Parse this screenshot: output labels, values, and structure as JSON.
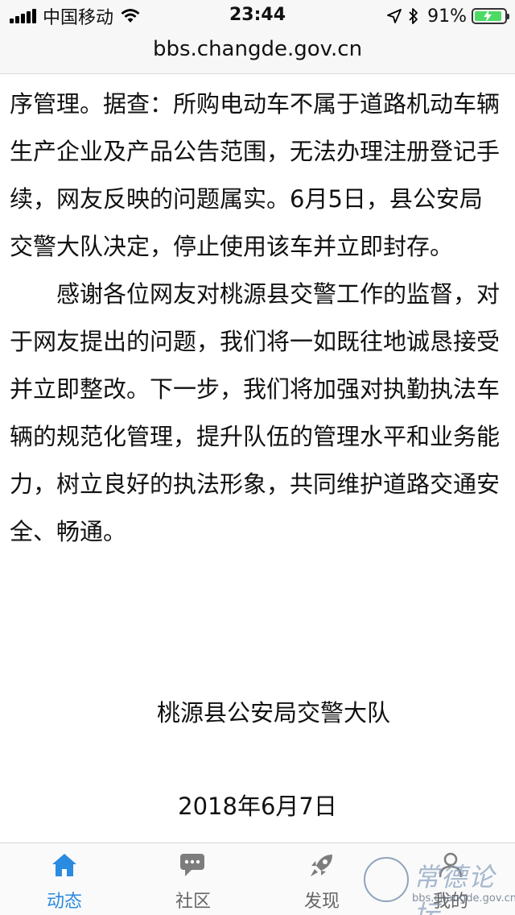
{
  "status_bar": {
    "carrier": "中国移动",
    "time": "23:44",
    "battery_percent": "91%",
    "battery_level": 0.91,
    "icons": [
      "signal-icon",
      "wifi-icon",
      "location-icon",
      "bluetooth-icon",
      "battery-icon"
    ]
  },
  "browser": {
    "url": "bbs.changde.gov.cn"
  },
  "article": {
    "paragraph_1": "序管理。据查：所购电动车不属于道路机动车辆生产企业及产品公告范围，无法办理注册登记手续，网友反映的问题属实。6月5日，县公安局交警大队决定，停止使用该车并立即封存。",
    "paragraph_2": "感谢各位网友对桃源县交警工作的监督，对于网友提出的问题，我们将一如既往地诚恳接受并立即整改。下一步，我们将加强对执勤执法车辆的规范化管理，提升队伍的管理水平和业务能力，树立良好的执法形象，共同维护道路交通安全、畅通。",
    "signature_org": "桃源县公安局交警大队",
    "signature_date": "2018年6月7日"
  },
  "tab_bar": {
    "tabs": [
      {
        "label": "动态",
        "icon": "home-icon",
        "active": true
      },
      {
        "label": "社区",
        "icon": "chat-icon",
        "active": false
      },
      {
        "label": "发现",
        "icon": "rocket-icon",
        "active": false
      },
      {
        "label": "我的",
        "icon": "user-icon",
        "active": false
      }
    ]
  },
  "watermark": {
    "title": "常德论坛",
    "url": "bbs.changde.gov.cn"
  },
  "colors": {
    "accent": "#2a8be0",
    "battery_green": "#4cd964",
    "bar_background": "#f7f7f7"
  }
}
